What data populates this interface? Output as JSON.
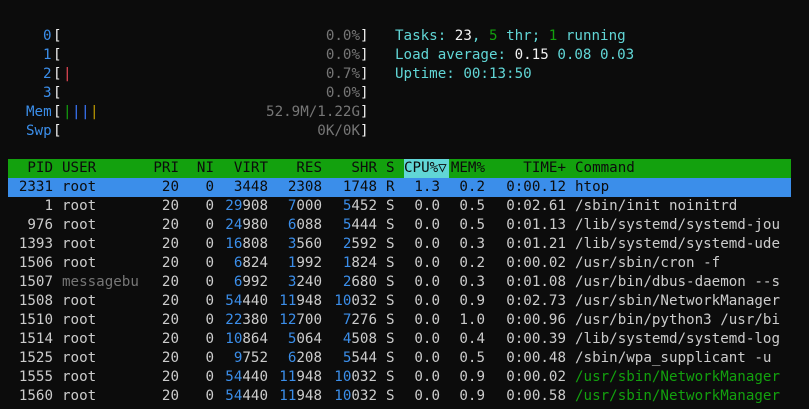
{
  "meters": {
    "cpus": [
      {
        "id": "0",
        "value": "0.0%",
        "bars": ""
      },
      {
        "id": "1",
        "value": "0.0%",
        "bars": ""
      },
      {
        "id": "2",
        "value": "0.7%",
        "bars": "|"
      },
      {
        "id": "3",
        "value": "0.0%",
        "bars": ""
      }
    ],
    "mem": {
      "label": "Mem",
      "value": "52.9M/1.22G",
      "bars": [
        "|",
        "|",
        "|",
        "|"
      ]
    },
    "swp": {
      "label": "Swp",
      "value": "0K/0K"
    }
  },
  "summary": {
    "tasks_label": "Tasks:",
    "tasks": "23",
    "thr": "5",
    "thr_label": "thr;",
    "running": "1",
    "running_label": "running",
    "load_label": "Load average:",
    "load1": "0.15",
    "load5": "0.08",
    "load15": "0.03",
    "uptime_label": "Uptime:",
    "uptime": "00:13:50"
  },
  "columns": [
    "PID",
    "USER",
    "PRI",
    "NI",
    "VIRT",
    "RES",
    "SHR",
    "S",
    "CPU%",
    "MEM%",
    "TIME+",
    "Command"
  ],
  "sort_column": "CPU%",
  "sort_indicator": "▽",
  "processes": [
    {
      "pid": "2331",
      "user": "root",
      "pri": "20",
      "ni": "0",
      "virt": "3448",
      "res": "2308",
      "shr": "1748",
      "s": "R",
      "cpu": "1.3",
      "mem": "0.2",
      "time": "0:00.12",
      "cmd": "htop",
      "selected": true
    },
    {
      "pid": "1",
      "user": "root",
      "pri": "20",
      "ni": "0",
      "virt": "29908",
      "res": "7000",
      "shr": "5452",
      "s": "S",
      "cpu": "0.0",
      "mem": "0.5",
      "time": "0:02.61",
      "cmd": "/sbin/init noinitrd"
    },
    {
      "pid": "976",
      "user": "root",
      "pri": "20",
      "ni": "0",
      "virt": "24980",
      "res": "6088",
      "shr": "5444",
      "s": "S",
      "cpu": "0.0",
      "mem": "0.5",
      "time": "0:01.13",
      "cmd": "/lib/systemd/systemd-jou"
    },
    {
      "pid": "1393",
      "user": "root",
      "pri": "20",
      "ni": "0",
      "virt": "16808",
      "res": "3560",
      "shr": "2592",
      "s": "S",
      "cpu": "0.0",
      "mem": "0.3",
      "time": "0:01.21",
      "cmd": "/lib/systemd/systemd-ude"
    },
    {
      "pid": "1506",
      "user": "root",
      "pri": "20",
      "ni": "0",
      "virt": "6824",
      "res": "1992",
      "shr": "1824",
      "s": "S",
      "cpu": "0.0",
      "mem": "0.2",
      "time": "0:00.02",
      "cmd": "/usr/sbin/cron -f"
    },
    {
      "pid": "1507",
      "user": "messagebu",
      "pri": "20",
      "ni": "0",
      "virt": "6992",
      "res": "3240",
      "shr": "2680",
      "s": "S",
      "cpu": "0.0",
      "mem": "0.3",
      "time": "0:01.08",
      "cmd": "/usr/bin/dbus-daemon --s",
      "dim_user": true
    },
    {
      "pid": "1508",
      "user": "root",
      "pri": "20",
      "ni": "0",
      "virt": "54440",
      "res": "11948",
      "shr": "10032",
      "s": "S",
      "cpu": "0.0",
      "mem": "0.9",
      "time": "0:02.73",
      "cmd": "/usr/sbin/NetworkManager"
    },
    {
      "pid": "1510",
      "user": "root",
      "pri": "20",
      "ni": "0",
      "virt": "22380",
      "res": "12700",
      "shr": "7276",
      "s": "S",
      "cpu": "0.0",
      "mem": "1.0",
      "time": "0:00.96",
      "cmd": "/usr/bin/python3 /usr/bi"
    },
    {
      "pid": "1514",
      "user": "root",
      "pri": "20",
      "ni": "0",
      "virt": "10864",
      "res": "5064",
      "shr": "4508",
      "s": "S",
      "cpu": "0.0",
      "mem": "0.4",
      "time": "0:00.39",
      "cmd": "/lib/systemd/systemd-log"
    },
    {
      "pid": "1525",
      "user": "root",
      "pri": "20",
      "ni": "0",
      "virt": "9752",
      "res": "6208",
      "shr": "5544",
      "s": "S",
      "cpu": "0.0",
      "mem": "0.5",
      "time": "0:00.48",
      "cmd": "/sbin/wpa_supplicant -u"
    },
    {
      "pid": "1555",
      "user": "root",
      "pri": "20",
      "ni": "0",
      "virt": "54440",
      "res": "11948",
      "shr": "10032",
      "s": "S",
      "cpu": "0.0",
      "mem": "0.9",
      "time": "0:00.02",
      "cmd": "/usr/sbin/NetworkManager",
      "thread": true
    },
    {
      "pid": "1560",
      "user": "root",
      "pri": "20",
      "ni": "0",
      "virt": "54440",
      "res": "11948",
      "shr": "10032",
      "s": "S",
      "cpu": "0.0",
      "mem": "0.9",
      "time": "0:00.58",
      "cmd": "/usr/sbin/NetworkManager",
      "thread": true
    }
  ],
  "colors": {
    "header_bg": "#13a10e",
    "selected_bg": "#3b8eea",
    "sorted_bg": "#61d6d6",
    "thread_cmd": "#13a10e"
  }
}
